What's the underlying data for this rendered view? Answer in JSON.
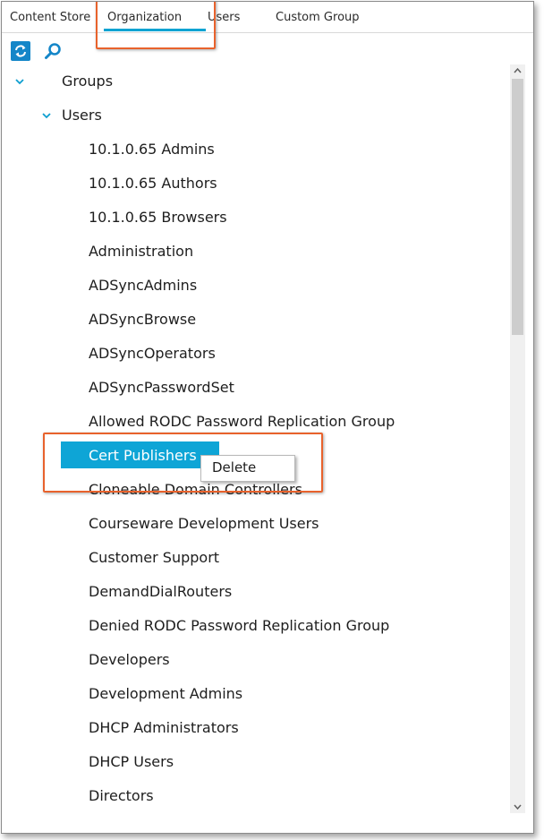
{
  "tabs": [
    {
      "label": "Content Store"
    },
    {
      "label": "Organization"
    },
    {
      "label": "Users"
    },
    {
      "label": "Custom Group"
    }
  ],
  "active_tab": "Organization",
  "toolbar": {
    "refresh_icon": "refresh-icon",
    "search_icon": "search-icon"
  },
  "tree": {
    "root": {
      "label": "Groups",
      "expanded": true
    },
    "child": {
      "label": "Users",
      "expanded": true
    },
    "items": [
      {
        "label": "10.1.0.65 Admins"
      },
      {
        "label": "10.1.0.65 Authors"
      },
      {
        "label": "10.1.0.65 Browsers"
      },
      {
        "label": "Administration"
      },
      {
        "label": "ADSyncAdmins"
      },
      {
        "label": "ADSyncBrowse"
      },
      {
        "label": "ADSyncOperators"
      },
      {
        "label": "ADSyncPasswordSet"
      },
      {
        "label": "Allowed RODC Password Replication Group"
      },
      {
        "label": "Cert Publishers",
        "selected": true
      },
      {
        "label": "Cloneable Domain Controllers"
      },
      {
        "label": "Courseware Development Users"
      },
      {
        "label": "Customer Support"
      },
      {
        "label": "DemandDialRouters"
      },
      {
        "label": "Denied RODC Password Replication Group"
      },
      {
        "label": "Developers"
      },
      {
        "label": "Development Admins"
      },
      {
        "label": "DHCP Administrators"
      },
      {
        "label": "DHCP Users"
      },
      {
        "label": "Directors"
      }
    ]
  },
  "context_menu": {
    "items": [
      {
        "label": "Delete"
      }
    ]
  },
  "colors": {
    "accent": "#0aa3d2",
    "selection": "#0ea5d6",
    "highlight_box": "#e8622c"
  }
}
